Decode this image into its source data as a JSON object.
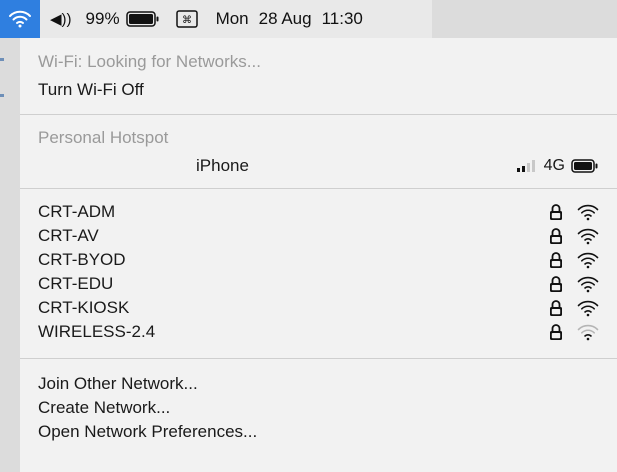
{
  "menubar": {
    "volume_icon": "speaker-volume-icon",
    "volume_text": "◀))",
    "battery_percent": "99%",
    "battery_icon": "battery-full-icon",
    "keyboard_icon": "command-key-icon",
    "clock_day": "Mon",
    "clock_date": "28 Aug",
    "clock_time": "11:30",
    "wifi_accent": "#2f7fe0"
  },
  "wifi_menu": {
    "status": "Wi-Fi: Looking for Networks...",
    "toggle": "Turn Wi-Fi Off",
    "hotspot_header": "Personal Hotspot",
    "hotspot": {
      "name": "iPhone",
      "network_type": "4G",
      "signal_bars": 2,
      "signal_bars_total": 4
    },
    "networks": [
      {
        "name": "CRT-ADM",
        "locked": true,
        "signal": "strong"
      },
      {
        "name": "CRT-AV",
        "locked": true,
        "signal": "strong"
      },
      {
        "name": "CRT-BYOD",
        "locked": true,
        "signal": "strong"
      },
      {
        "name": "CRT-EDU",
        "locked": true,
        "signal": "strong"
      },
      {
        "name": "CRT-KIOSK",
        "locked": true,
        "signal": "strong"
      },
      {
        "name": "WIRELESS-2.4",
        "locked": true,
        "signal": "weak"
      }
    ],
    "actions": [
      "Join Other Network...",
      "Create Network...",
      "Open Network Preferences..."
    ]
  }
}
